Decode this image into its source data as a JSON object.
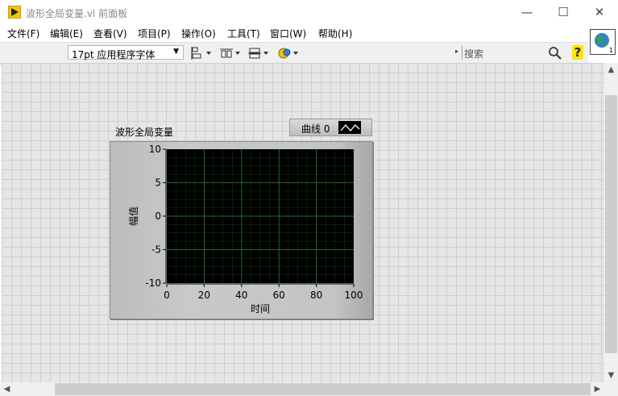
{
  "window": {
    "title": "波形全局变量.vi 前面板",
    "minimize": "—",
    "maximize": "☐",
    "close": "✕"
  },
  "menu": [
    "文件(F)",
    "编辑(E)",
    "查看(V)",
    "项目(P)",
    "操作(O)",
    "工具(T)",
    "窗口(W)",
    "帮助(H)"
  ],
  "toolbar": {
    "font_value": "17pt 应用程序字体",
    "search_placeholder": "搜索",
    "help": "?"
  },
  "vi_icon": {
    "connector_number": "1"
  },
  "graph": {
    "label": "波形全局变量",
    "legend_label": "曲线 0",
    "chart_data": {
      "type": "line",
      "title": "",
      "xlabel": "时间",
      "ylabel": "幅值",
      "xlim": [
        0,
        100
      ],
      "ylim": [
        -10,
        10
      ],
      "x_ticks": [
        "0",
        "20",
        "40",
        "60",
        "80",
        "100"
      ],
      "y_ticks": [
        "10",
        "5",
        "0",
        "-5",
        "-10"
      ],
      "grid": true,
      "series": [
        {
          "name": "曲线 0",
          "x": [],
          "y": []
        }
      ]
    }
  },
  "colors": {
    "plot_background": "#000000",
    "grid_line": "#1f6b2e",
    "canvas": "#e6e6e6"
  }
}
